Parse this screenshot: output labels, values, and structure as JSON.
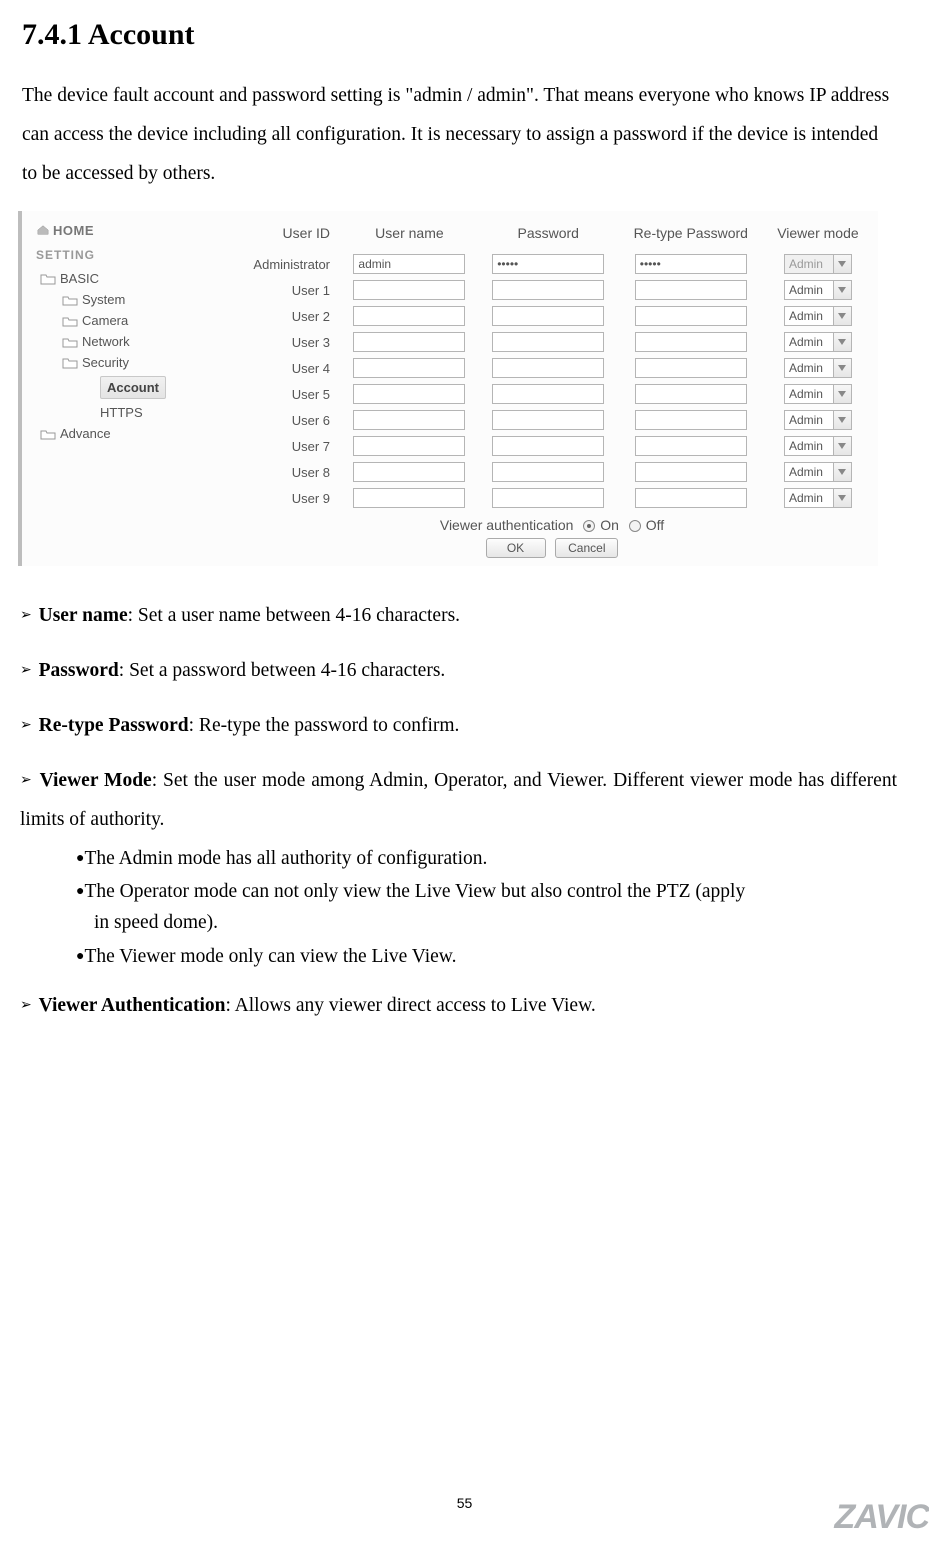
{
  "title": "7.4.1 Account",
  "intro": "The device fault account and password setting is \"admin / admin\". That means everyone who knows IP address can access the device including all configuration. It is necessary to assign a password if the device is intended to be accessed by others.",
  "sidebar": {
    "home": "HOME",
    "setting": "SETTING",
    "basic": "BASIC",
    "system": "System",
    "camera": "Camera",
    "network": "Network",
    "security": "Security",
    "account": "Account",
    "https": "HTTPS",
    "advance": "Advance"
  },
  "table_head": {
    "userid": "User ID",
    "username": "User name",
    "password": "Password",
    "retype": "Re-type Password",
    "viewer": "Viewer mode"
  },
  "admin_row": {
    "label": "Administrator",
    "username": "admin",
    "password": "•••••",
    "retype": "•••••",
    "mode": "Admin"
  },
  "rows": [
    {
      "label": "User 1",
      "mode": "Admin"
    },
    {
      "label": "User 2",
      "mode": "Admin"
    },
    {
      "label": "User 3",
      "mode": "Admin"
    },
    {
      "label": "User 4",
      "mode": "Admin"
    },
    {
      "label": "User 5",
      "mode": "Admin"
    },
    {
      "label": "User 6",
      "mode": "Admin"
    },
    {
      "label": "User 7",
      "mode": "Admin"
    },
    {
      "label": "User 8",
      "mode": "Admin"
    },
    {
      "label": "User 9",
      "mode": "Admin"
    }
  ],
  "auth": {
    "label": "Viewer authentication",
    "on": "On",
    "off": "Off"
  },
  "buttons": {
    "ok": "OK",
    "cancel": "Cancel"
  },
  "b1_label": "User name",
  "b1_text": ": Set a user name between 4-16 characters.",
  "b2_label": "Password",
  "b2_text": ": Set a password between 4-16 characters.",
  "b3_label": "Re-type Password",
  "b3_text": ": Re-type the password to confirm.",
  "b4_label": "Viewer Mode",
  "b4_text": ": Set the user mode among Admin, Operator, and Viewer. Different viewer mode has different limits of authority.",
  "sub1": "The Admin mode has all authority of configuration.",
  "sub2a": "The Operator mode can not only view the Live View but also control the PTZ (apply",
  "sub2b": "in speed dome).",
  "sub3": "The Viewer mode only can view the Live View.",
  "b5_label": "Viewer Authentication",
  "b5_text": ": Allows any viewer direct access to Live View.",
  "page_number": "55",
  "brand": "ZAVIC"
}
